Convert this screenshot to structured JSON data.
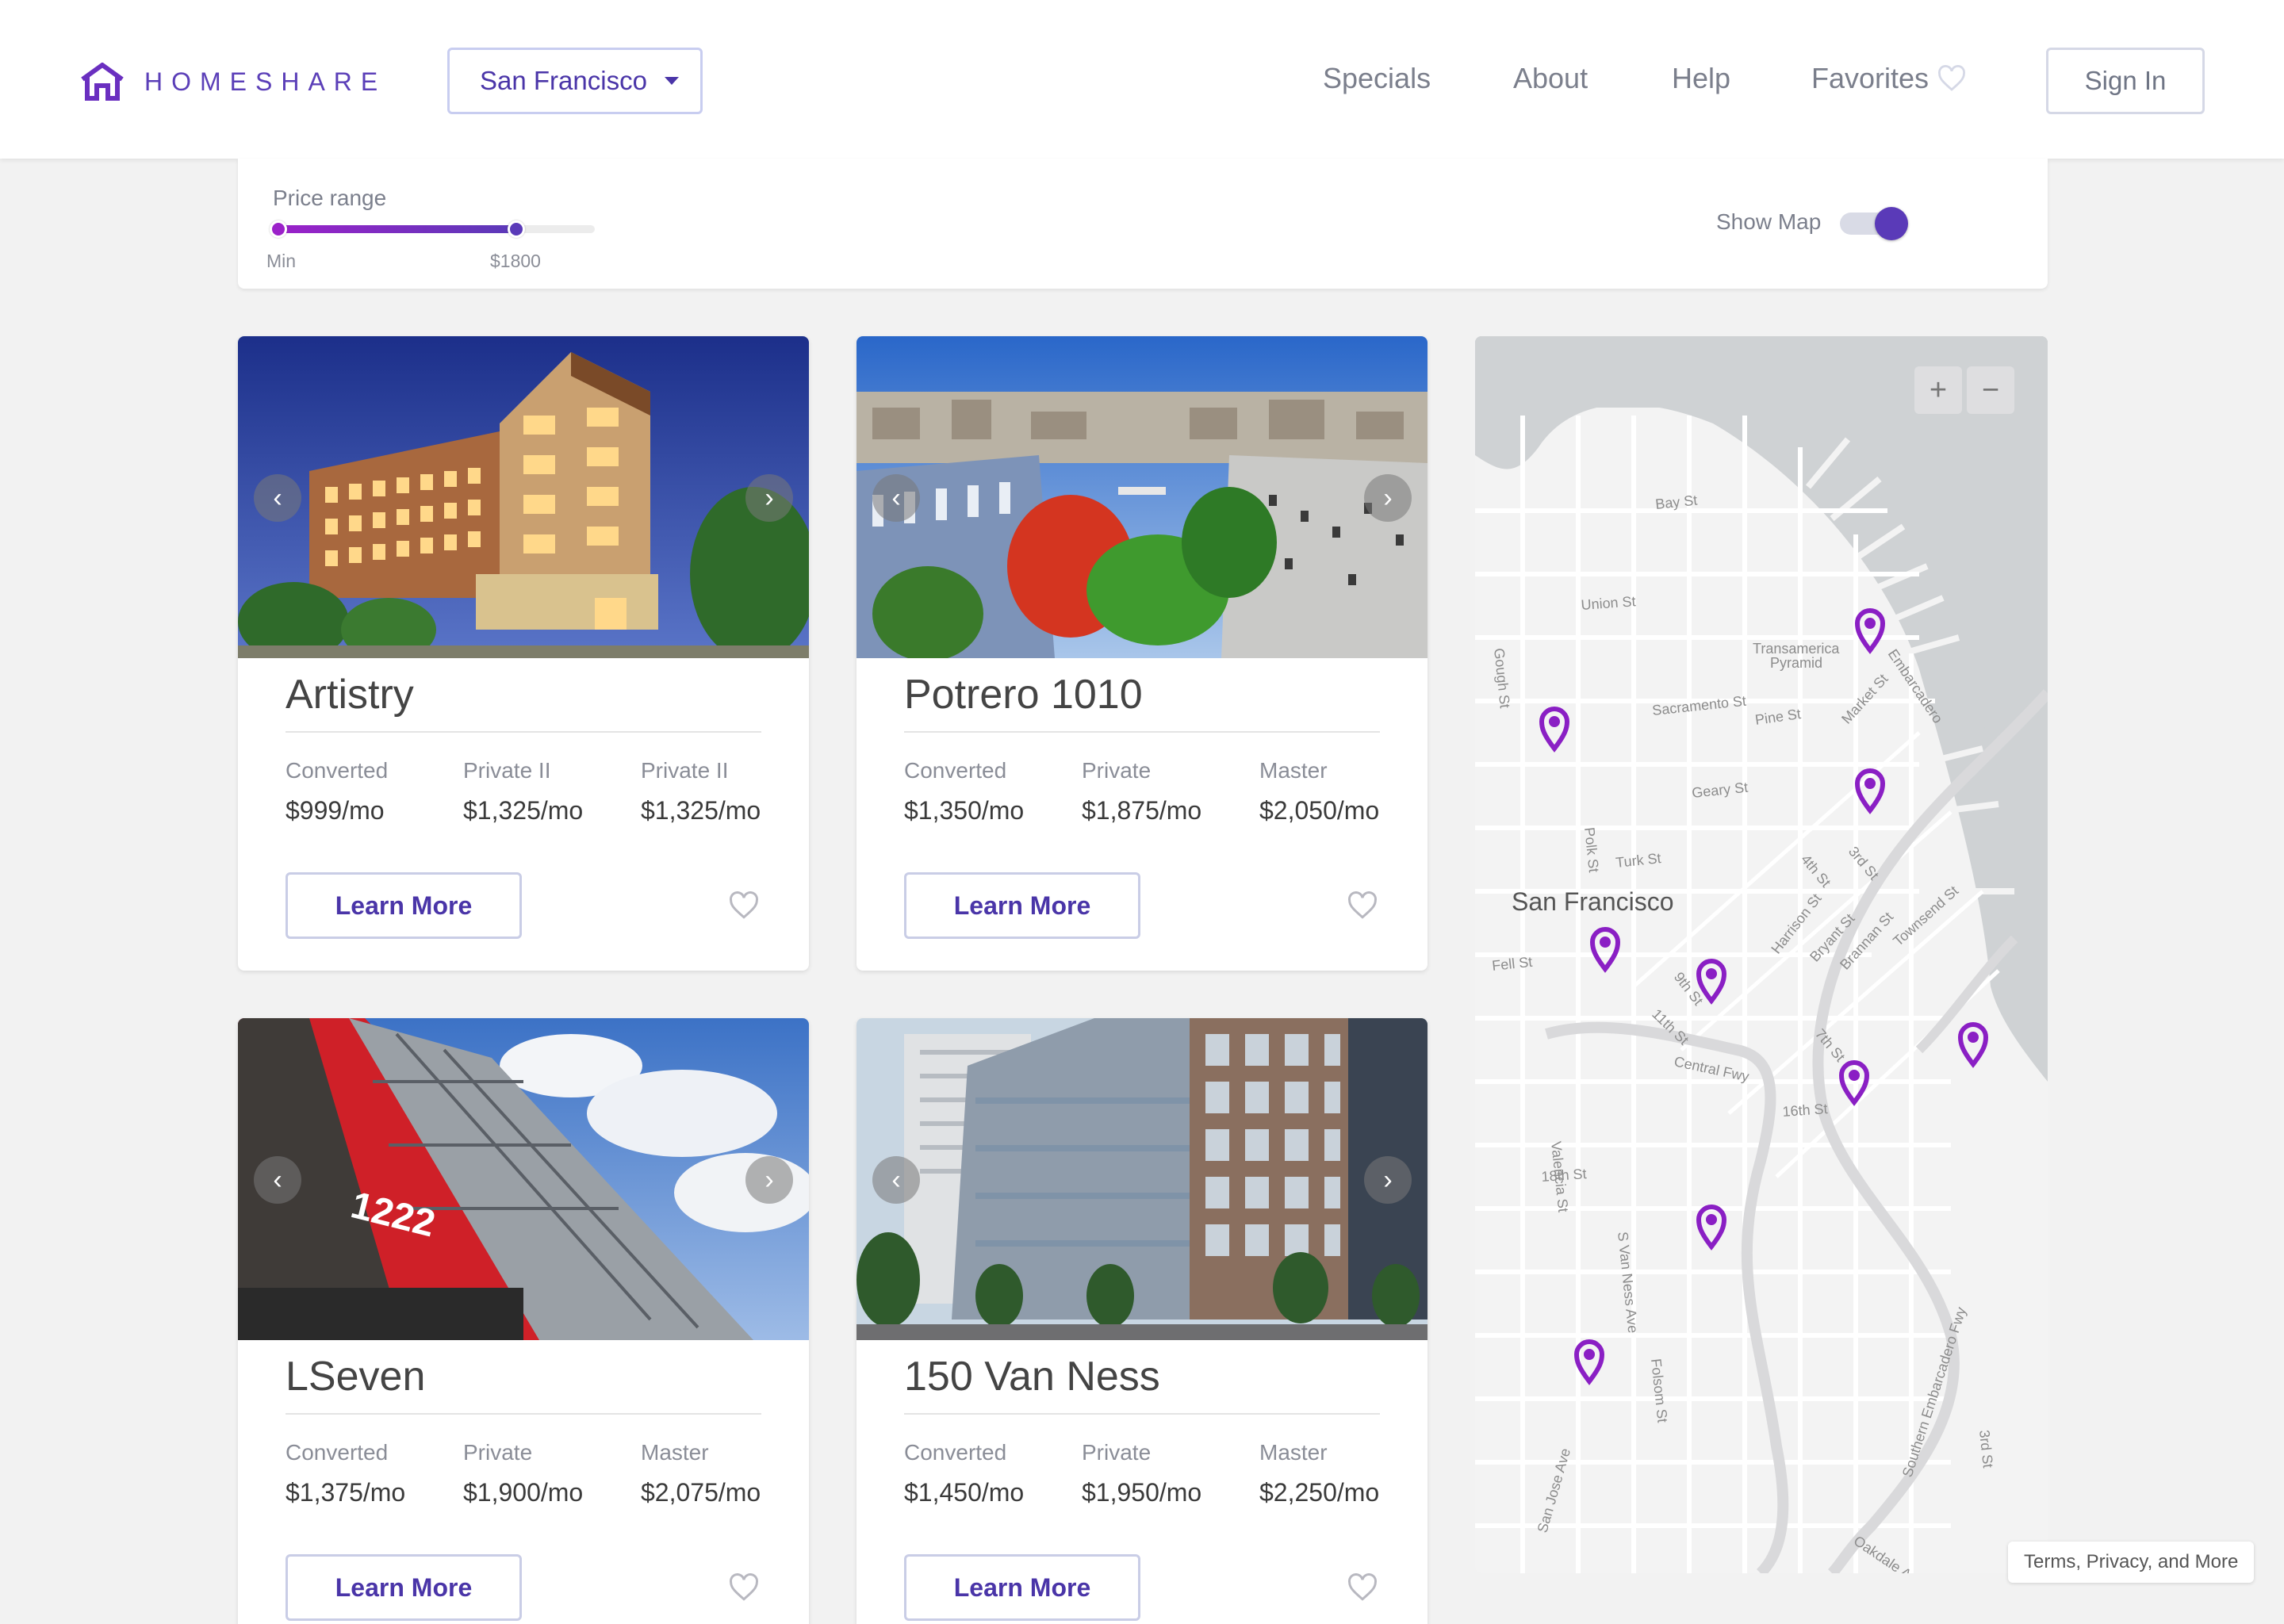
{
  "header": {
    "logo_text": "HOMESHARE",
    "city": "San Francisco",
    "nav": [
      "Specials",
      "About",
      "Help",
      "Favorites"
    ],
    "sign_in": "Sign In"
  },
  "filter": {
    "price_label": "Price range",
    "min_label": "Min",
    "max_label": "$1800",
    "show_map_label": "Show Map",
    "show_map": true
  },
  "listings": [
    {
      "name": "Artistry",
      "prices": [
        {
          "label": "Converted",
          "value": "$999/mo"
        },
        {
          "label": "Private II",
          "value": "$1,325/mo"
        },
        {
          "label": "Private II",
          "value": "$1,325/mo"
        }
      ],
      "cta": "Learn More"
    },
    {
      "name": "Potrero 1010",
      "prices": [
        {
          "label": "Converted",
          "value": "$1,350/mo"
        },
        {
          "label": "Private",
          "value": "$1,875/mo"
        },
        {
          "label": "Master",
          "value": "$2,050/mo"
        }
      ],
      "cta": "Learn More"
    },
    {
      "name": "LSeven",
      "building_sign": "1222",
      "prices": [
        {
          "label": "Converted",
          "value": "$1,375/mo"
        },
        {
          "label": "Private",
          "value": "$1,900/mo"
        },
        {
          "label": "Master",
          "value": "$2,075/mo"
        }
      ],
      "cta": "Learn More"
    },
    {
      "name": "150 Van Ness",
      "prices": [
        {
          "label": "Converted",
          "value": "$1,450/mo"
        },
        {
          "label": "Private",
          "value": "$1,950/mo"
        },
        {
          "label": "Master",
          "value": "$2,250/mo"
        }
      ],
      "cta": "Learn More"
    }
  ],
  "map": {
    "city_label": "San Francisco",
    "streets": [
      "Bay St",
      "Union St",
      "Transamerica",
      "Pyramid",
      "Sacramento St",
      "Pine St",
      "Market St",
      "Embarcadero",
      "Gough St",
      "Geary St",
      "Polk St",
      "Turk St",
      "4th St",
      "3rd St",
      "Townsend St",
      "Harrison St",
      "Bryant St",
      "Brannan St",
      "Fell St",
      "9th St",
      "11th St",
      "Central Fwy",
      "7th St",
      "16th St",
      "18th St",
      "Valencia St",
      "S Van Ness Ave",
      "Folsom St",
      "Southern Embarcadero Fwy",
      "3rd St",
      "San Jose Ave",
      "Oakdale Ave"
    ],
    "zoom_in": "+",
    "zoom_out": "−",
    "terms": "Terms, Privacy, and More"
  },
  "colors": {
    "brand": "#5b3fb8",
    "pin": "#8a1fc4",
    "accent": "#4a35a8"
  }
}
